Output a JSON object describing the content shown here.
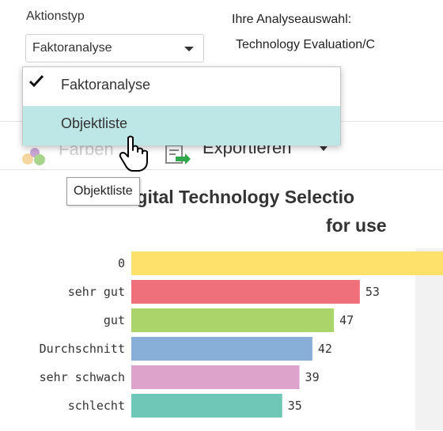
{
  "header": {
    "action_type_label": "Aktionstyp",
    "action_select_value": "Faktoranalyse",
    "analysis_label": "Ihre Analyseauswahl:",
    "analysis_value": "Technology Evaluation/C"
  },
  "dropdown": {
    "items": [
      {
        "label": "Faktoranalyse",
        "checked": true
      },
      {
        "label": "Objektliste",
        "hovered": true
      }
    ],
    "hover_color": "#bde6e6"
  },
  "toolbar": {
    "color_label": "Farben",
    "export_label": "Exportieren"
  },
  "tooltip": {
    "text": "Objektliste"
  },
  "chart_data": {
    "type": "bar",
    "orientation": "horizontal",
    "title_line1": "igital Technology Selectio",
    "title_line2": "for use",
    "categories": [
      "0",
      "sehr gut",
      "gut",
      "Durchschnitt",
      "sehr schwach",
      "schlecht"
    ],
    "values": [
      null,
      53,
      47,
      42,
      39,
      35
    ],
    "value_labels": [
      "",
      "53",
      "47",
      "42",
      "39",
      "35"
    ],
    "colors": [
      "#fde16a",
      "#ef6f7a",
      "#abd46b",
      "#88afd8",
      "#dea3cb",
      "#6ec7b7"
    ],
    "first_bar_extends_offscreen": true
  }
}
